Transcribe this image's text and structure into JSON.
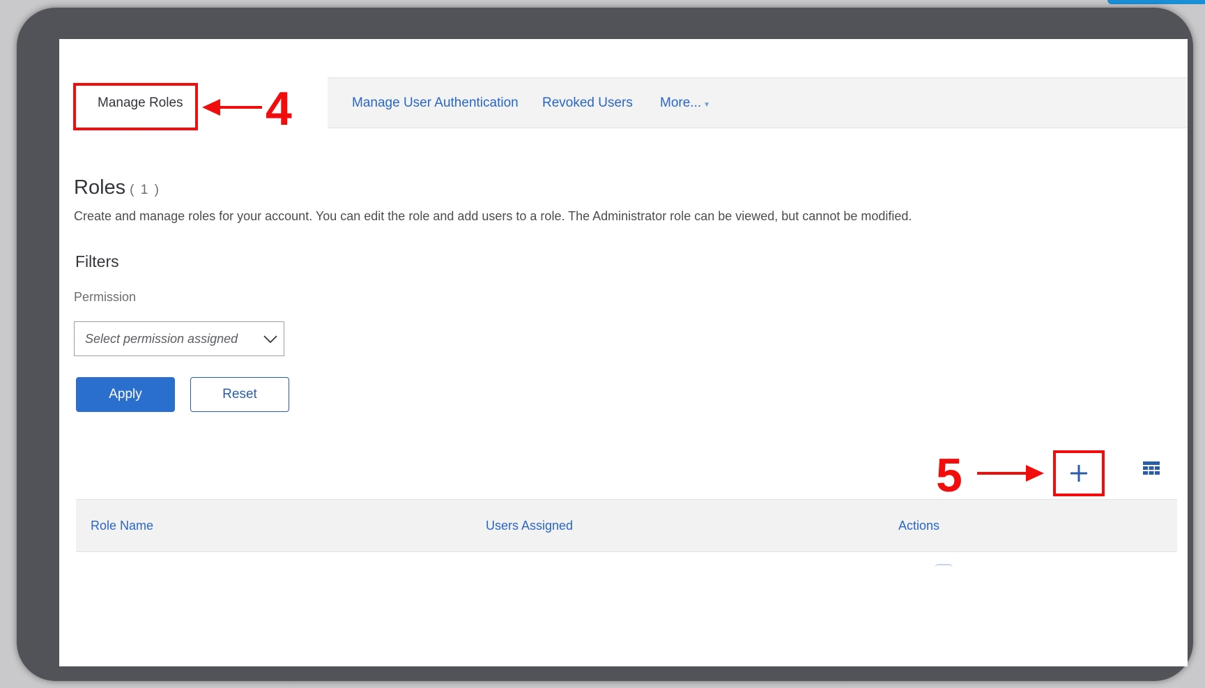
{
  "tabs": {
    "active_label": "Manage Roles",
    "items": [
      "Manage User Authentication",
      "Revoked Users",
      "More..."
    ],
    "more_caret": "▼"
  },
  "roles": {
    "title": "Roles",
    "count": "( 1 )",
    "description": "Create and manage roles for your account. You can edit the role and add users to a role. The Administrator role can be viewed, but cannot be modified."
  },
  "filters": {
    "title": "Filters",
    "permission_label": "Permission",
    "permission_placeholder": "Select permission assigned",
    "apply_label": "Apply",
    "reset_label": "Reset"
  },
  "table": {
    "columns": [
      "Role Name",
      "Users Assigned",
      "Actions"
    ]
  },
  "annotations": {
    "step_4": "4",
    "step_5": "5",
    "color": "#f20d0d"
  },
  "colors": {
    "primary": "#2b6fce",
    "link": "#2a66c4",
    "frame": "#515358"
  },
  "icons": {
    "add": "plus-icon",
    "table_settings": "table-grid-icon",
    "dropdown": "chevron-down-icon"
  }
}
